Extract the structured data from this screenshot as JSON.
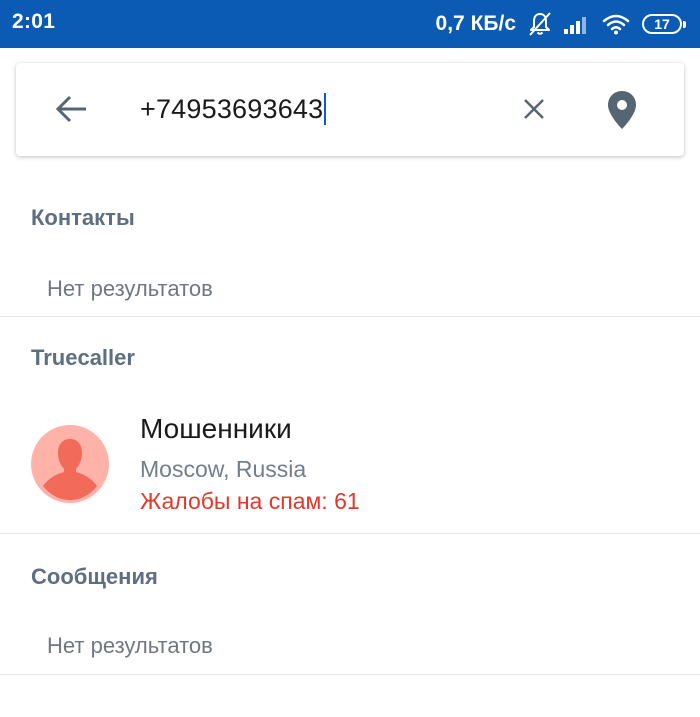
{
  "status_bar": {
    "time": "2:01",
    "net_speed": "0,7 КБ/с",
    "battery": "17",
    "icons": [
      "muted-bell-icon",
      "cellular-signal-icon",
      "wifi-icon",
      "battery-icon"
    ],
    "bg_color": "#0b5bb5"
  },
  "search": {
    "query": "+74953693643",
    "icons": [
      "back-arrow-icon",
      "clear-icon",
      "location-pin-icon"
    ]
  },
  "sections": {
    "contacts": {
      "header": "Контакты",
      "empty_text": "Нет результатов"
    },
    "truecaller": {
      "header": "Truecaller",
      "result": {
        "name": "Мошенники",
        "location": "Moscow, Russia",
        "spam_reports": "Жалобы на спам: 61",
        "avatar_icon": "person-silhouette-icon"
      }
    },
    "messages": {
      "header": "Сообщения",
      "empty_text": "Нет результатов"
    }
  },
  "colors": {
    "accent": "#0b5bb5",
    "section_header": "#5d6f80",
    "spam_red": "#e0392b",
    "avatar_bg": "#ffb3a8",
    "avatar_fg": "#f26a5a"
  }
}
